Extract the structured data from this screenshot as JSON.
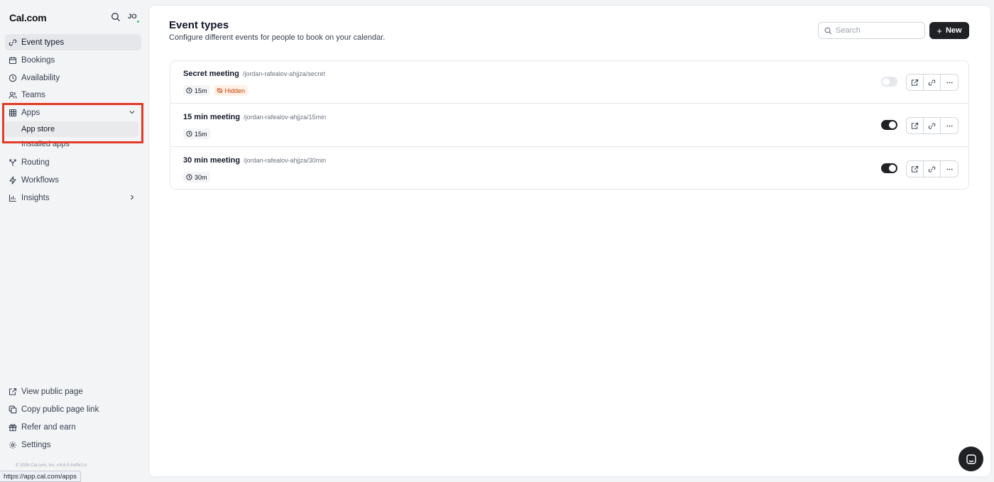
{
  "brand": "Cal.com",
  "user_initials": "JO",
  "nav": {
    "event_types": "Event types",
    "bookings": "Bookings",
    "availability": "Availability",
    "teams": "Teams",
    "apps": "Apps",
    "app_store": "App store",
    "installed_apps": "Installed apps",
    "routing": "Routing",
    "workflows": "Workflows",
    "insights": "Insights"
  },
  "footer_nav": {
    "view_public_page": "View public page",
    "copy_public_page_link": "Copy public page link",
    "refer_and_earn": "Refer and earn",
    "settings": "Settings"
  },
  "copyright": "© 2026 Cal.com, Inc. v.6.6.0-hotfix1-h",
  "status_url": "https://app.cal.com/apps",
  "header": {
    "title": "Event types",
    "subtitle": "Configure different events for people to book on your calendar.",
    "search_placeholder": "Search",
    "new_label": "New"
  },
  "events": [
    {
      "title": "Secret meeting",
      "slug": "/jordan-rafealov-ahjjza/secret",
      "duration": "15m",
      "hidden_label": "Hidden",
      "enabled": false
    },
    {
      "title": "15 min meeting",
      "slug": "/jordan-rafealov-ahjjza/15min",
      "duration": "15m",
      "enabled": true
    },
    {
      "title": "30 min meeting",
      "slug": "/jordan-rafealov-ahjjza/30min",
      "duration": "30m",
      "enabled": true
    }
  ],
  "colors": {
    "highlight": "#e23b2a",
    "primary": "#1f2125",
    "hidden_badge": "#c2410c",
    "online_dot": "#22c55e"
  }
}
